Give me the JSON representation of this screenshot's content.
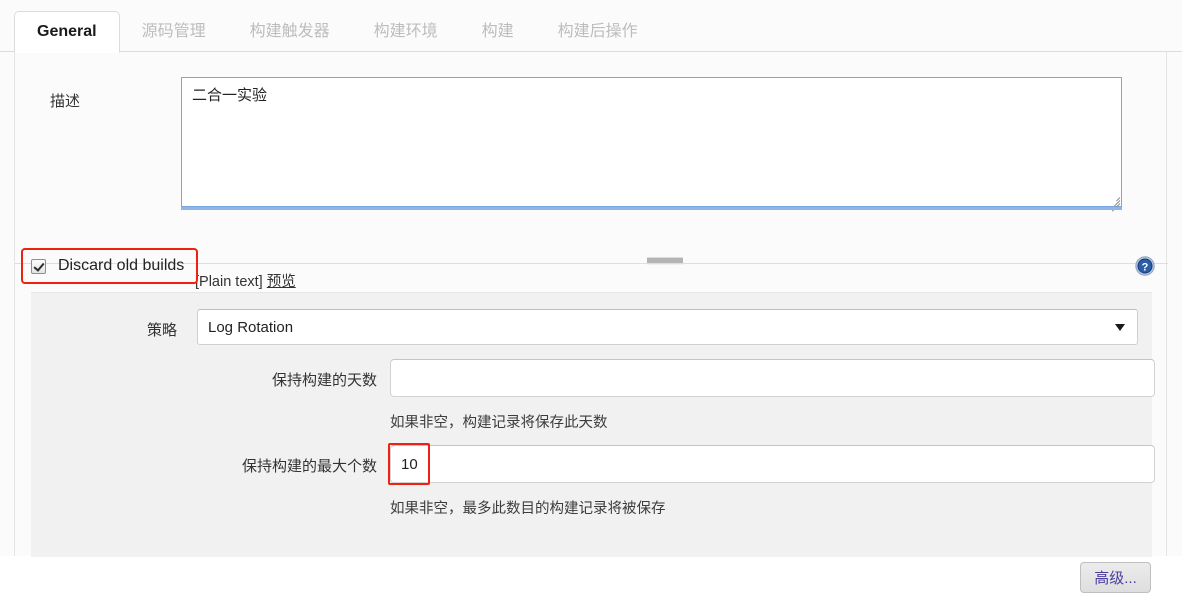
{
  "tabs": [
    {
      "label": "General",
      "active": true
    },
    {
      "label": "源码管理",
      "active": false
    },
    {
      "label": "构建触发器",
      "active": false
    },
    {
      "label": "构建环境",
      "active": false
    },
    {
      "label": "构建",
      "active": false
    },
    {
      "label": "构建后操作",
      "active": false
    }
  ],
  "description": {
    "label": "描述",
    "value": "二合一实验",
    "placeholder": "",
    "markup_note": "[Plain text]",
    "preview_link": "预览"
  },
  "discard": {
    "label": "Discard old builds",
    "checked": true,
    "help_icon": "help-circle-icon",
    "highlight_color": "#ee2211"
  },
  "strategy": {
    "label": "策略",
    "selected": "Log Rotation",
    "options": [
      "Log Rotation"
    ],
    "caret_icon": "chevron-down-icon"
  },
  "days_to_keep": {
    "label": "保持构建的天数",
    "value": "",
    "hint": "如果非空，构建记录将保存此天数"
  },
  "max_builds_to_keep": {
    "label": "保持构建的最大个数",
    "value": "10",
    "hint": "如果非空，最多此数目的构建记录将被保存",
    "highlighted": true
  },
  "advanced_button": {
    "label": "高级..."
  },
  "colors": {
    "accent_border": "#7aa7e0",
    "annotation": "#ee2211",
    "panel_bg": "#fbfbfb",
    "nested_bg": "#f1f1f1",
    "link": "#4a3f9e"
  }
}
